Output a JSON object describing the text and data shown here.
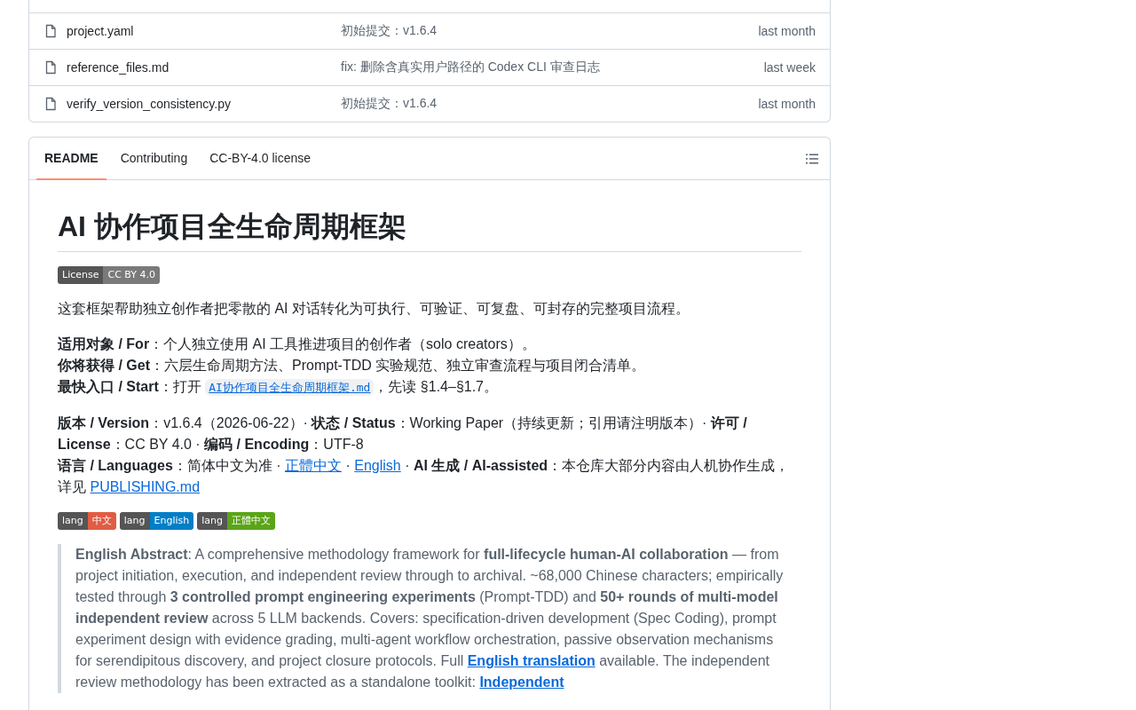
{
  "files": [
    {
      "name": "project.yaml",
      "commit": "初始提交：v1.6.4",
      "time": "last month"
    },
    {
      "name": "reference_files.md",
      "commit": "fix: 删除含真实用户路径的 Codex CLI 审查日志",
      "time": "last week"
    },
    {
      "name": "verify_version_consistency.py",
      "commit": "初始提交：v1.6.4",
      "time": "last month"
    }
  ],
  "readme": {
    "tabs": [
      {
        "label": "README",
        "selected": true
      },
      {
        "label": "Contributing",
        "selected": false
      },
      {
        "label": "CC-BY-4.0 license",
        "selected": false
      }
    ],
    "title": "AI 协作项目全生命周期框架",
    "blocks": [
      {
        "kind": "badges",
        "badges": [
          {
            "label": "License",
            "message": "CC BY 4.0",
            "color": "#7a7a7a"
          }
        ]
      },
      {
        "kind": "p",
        "lines": [
          [
            {
              "kind": "text",
              "text": "这套框架帮助独立创作者把零散的 AI 对话转化为可执行、可验证、可复盘、可封存的完整项目流程。"
            }
          ]
        ]
      },
      {
        "kind": "p",
        "lines": [
          [
            {
              "kind": "text",
              "text": "**适用对象 / For**：个人独立使用 AI 工具推进项目的创作者（solo creators）。"
            }
          ],
          [
            {
              "kind": "text",
              "text": "**你将获得 / Get**：六层生命周期方法、Prompt-TDD 实验规范、独立审查流程与项目闭合清单。"
            }
          ],
          [
            {
              "kind": "text",
              "text": "**最快入口 / Start**：打开 "
            },
            {
              "kind": "code",
              "text": "AI协作项目全生命周期框架.md"
            },
            {
              "kind": "text",
              "text": "，先读 §1.4–§1.7。"
            }
          ]
        ]
      },
      {
        "kind": "p",
        "lines": [
          [
            {
              "kind": "text",
              "text": "**版本 / Version**：v1.6.4（2026-06-22）· **状态 / Status**：Working Paper（持续更新；引用请注明版本）· **许可 / License**：CC BY 4.0 · **编码 / Encoding**：UTF-8"
            }
          ],
          [
            {
              "kind": "text",
              "text": "**语言 / Languages**：简体中文为准 · "
            },
            {
              "kind": "link",
              "text": "正體中文"
            },
            {
              "kind": "text",
              "text": " · "
            },
            {
              "kind": "link",
              "text": "English"
            },
            {
              "kind": "text",
              "text": " · **AI 生成 / AI-assisted**：本仓库大部分内容由人机协作生成，详见 "
            },
            {
              "kind": "link",
              "text": "PUBLISHING.md"
            }
          ]
        ]
      },
      {
        "kind": "badges",
        "badges": [
          {
            "label": "lang",
            "message": "中文",
            "color": "#e05d44"
          },
          {
            "label": "lang",
            "message": "English",
            "color": "#007ec6"
          },
          {
            "label": "lang",
            "message": "正體中文",
            "color": "#5aa517"
          }
        ]
      },
      {
        "kind": "quote",
        "lines": [
          [
            {
              "kind": "text",
              "text": "**English Abstract**: A comprehensive methodology framework for **full-lifecycle human-AI collaboration** — from project initiation, execution, and independent review through to archival. ~68,000 Chinese characters; empirically tested through **3 controlled prompt engineering experiments** (Prompt-TDD) and **50+ rounds of multi-model independent review** across 5 LLM backends. Covers: specification-driven development (Spec Coding), prompt experiment design with evidence grading, multi-agent workflow orchestration, passive observation mechanisms for serendipitous discovery, and project closure protocols. Full "
            },
            {
              "kind": "boldlink",
              "text": "English translation"
            },
            {
              "kind": "text",
              "text": " available. The independent review methodology has been extracted as a standalone toolkit: "
            },
            {
              "kind": "boldlink",
              "text": "Independent"
            }
          ]
        ]
      }
    ]
  }
}
